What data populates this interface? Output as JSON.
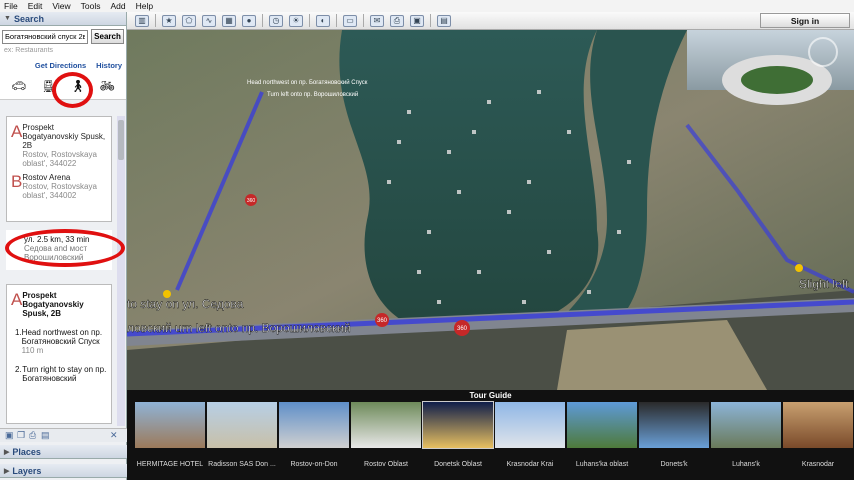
{
  "menu": [
    "File",
    "Edit",
    "View",
    "Tools",
    "Add",
    "Help"
  ],
  "search": {
    "section_title": "Search",
    "query": "Богатяновский спуск 2в to пр",
    "button": "Search",
    "hint": "ex: Restaurants",
    "get_directions": "Get Directions",
    "history": "History"
  },
  "route": {
    "a_letter": "A",
    "a_name": "Prospekt Bogatyanovskiy Spusk, 2B",
    "a_addr": "Rostov, Rostovskaya oblast', 344022",
    "b_letter": "B",
    "b_name": "Rostov Arena",
    "b_addr": "Rostov, Rostovskaya oblast', 344002",
    "summary_prefix": "ул.",
    "summary": "2.5 km,  33 min",
    "summary_sub": "Седова and мост Ворошиловский"
  },
  "steps_card": {
    "letter": "A",
    "title": "Prospekt Bogatyanovskiy Spusk, 2B",
    "step1_num": "1.",
    "step1_text": "Head northwest on пр. Богатяновский Спуск",
    "step1_dist": "110 m",
    "step2_num": "2.",
    "step2_text": "Turn right to stay on пр. Богатяновский"
  },
  "panels": {
    "places": "Places",
    "layers": "Layers"
  },
  "toolbar": {
    "sign_in": "Sign in"
  },
  "map_labels": {
    "head_label": "Head northwest",
    "turn_label": "Turn left onto пр. Ворошиловский",
    "stay_label": "to stay on ул. Седова",
    "turn_label2": "ловский urn left onto пр. Ворошиловский",
    "slight_left": "Slight left",
    "pin360_1": "360",
    "pin360_2": "360",
    "pin360_3": "360",
    "top_small": "Head northwest on пр. Богатяновский Спуск",
    "top_small2": "Turn left onto пр. Ворошиловский"
  },
  "tour": {
    "title": "Tour Guide",
    "items": [
      "HERMITAGE HOTEL",
      "Radisson SAS Don ...",
      "Rostov-on-Don",
      "Rostov Oblast",
      "Donetsk Oblast",
      "Krasnodar Krai",
      "Luhans'ka oblast",
      "Donets'k",
      "Luhans'k",
      "Krasnodar"
    ]
  },
  "colors": {
    "route": "#3b3fd8",
    "accent": "#c0504d",
    "circle": "#e01010",
    "water": "#2e5a52"
  }
}
